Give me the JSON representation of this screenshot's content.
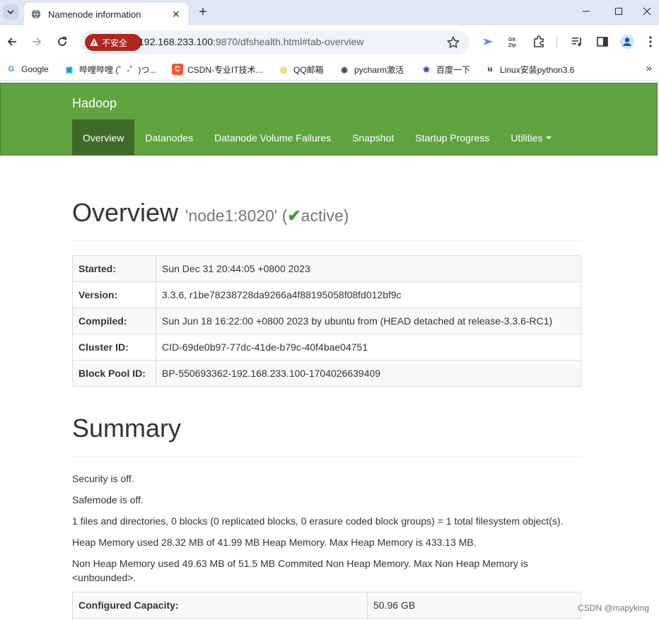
{
  "browser": {
    "tab_title": "Namenode information",
    "insecure_label": "不安全",
    "url_host": "192.168.233.100",
    "url_path": ":9870/dfshealth.html#tab-overview",
    "bookmarks": [
      {
        "label": "Google",
        "icon": "G",
        "color": "#4285f4"
      },
      {
        "label": "哔哩哔哩 (゜-゜)つ...",
        "icon": "▣",
        "color": "#00a1d6"
      },
      {
        "label": "CSDN-专业IT技术...",
        "icon": "C",
        "color": "#fc5531"
      },
      {
        "label": "QQ邮箱",
        "icon": "◎",
        "color": "#f4b400"
      },
      {
        "label": "pycharm激活",
        "icon": "◉",
        "color": "#444"
      },
      {
        "label": "百度一下",
        "icon": "❀",
        "color": "#2932e1"
      },
      {
        "label": "Linux安装python3.6",
        "icon": "ʉ",
        "color": "#444"
      }
    ]
  },
  "hadoop": {
    "brand": "Hadoop",
    "nav": [
      "Overview",
      "Datanodes",
      "Datanode Volume Failures",
      "Snapshot",
      "Startup Progress",
      "Utilities"
    ]
  },
  "overview": {
    "title": "Overview",
    "node_prefix": "'node1:8020' (",
    "check": "✔",
    "state": "active",
    "node_suffix": ")",
    "rows": [
      {
        "k": "Started:",
        "v": "Sun Dec 31 20:44:05 +0800 2023"
      },
      {
        "k": "Version:",
        "v": "3.3.6, r1be78238728da9266a4f88195058f08fd012bf9c"
      },
      {
        "k": "Compiled:",
        "v": "Sun Jun 18 16:22:00 +0800 2023 by ubuntu from (HEAD detached at release-3.3.6-RC1)"
      },
      {
        "k": "Cluster ID:",
        "v": "CID-69de0b97-77dc-41de-b79c-40f4bae04751"
      },
      {
        "k": "Block Pool ID:",
        "v": "BP-550693362-192.168.233.100-1704026639409"
      }
    ]
  },
  "summary": {
    "title": "Summary",
    "lines": [
      "Security is off.",
      "Safemode is off.",
      "1 files and directories, 0 blocks (0 replicated blocks, 0 erasure coded block groups) = 1 total filesystem object(s).",
      "Heap Memory used 28.32 MB of 41.99 MB Heap Memory. Max Heap Memory is 433.13 MB.",
      "Non Heap Memory used 49.63 MB of 51.5 MB Commited Non Heap Memory. Max Non Heap Memory is <unbounded>."
    ],
    "capacity_label": "Configured Capacity:",
    "capacity_value": "50.96 GB"
  },
  "watermark": "CSDN @mapyking"
}
